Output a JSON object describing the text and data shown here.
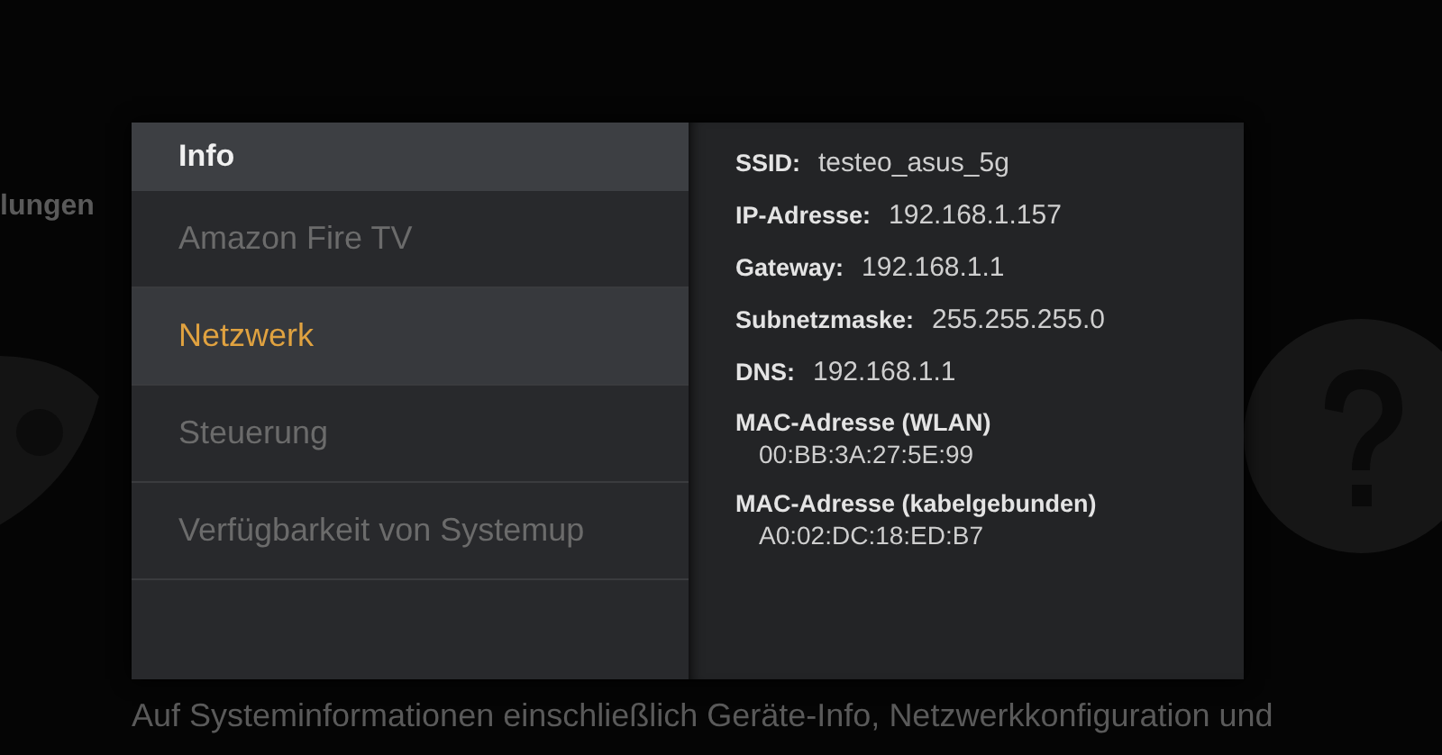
{
  "background": {
    "left_label": "lungen",
    "description": "Auf Systeminformationen einschließlich Geräte-Info, Netzwerkkonfiguration und"
  },
  "menu": {
    "title": "Info",
    "items": [
      {
        "label": "Amazon Fire TV",
        "selected": false
      },
      {
        "label": "Netzwerk",
        "selected": true
      },
      {
        "label": "Steuerung",
        "selected": false
      },
      {
        "label": "Verfügbarkeit von Systemup",
        "selected": false
      }
    ]
  },
  "details": [
    {
      "kind": "inline",
      "label": "SSID:",
      "value": "testeo_asus_5g"
    },
    {
      "kind": "inline",
      "label": "IP-Adresse:",
      "value": "192.168.1.157"
    },
    {
      "kind": "inline",
      "label": "Gateway:",
      "value": "192.168.1.1"
    },
    {
      "kind": "inline",
      "label": "Subnetzmaske:",
      "value": "255.255.255.0"
    },
    {
      "kind": "inline",
      "label": "DNS:",
      "value": "192.168.1.1"
    },
    {
      "kind": "stacked",
      "label": "MAC-Adresse (WLAN)",
      "value": "00:BB:3A:27:5E:99"
    },
    {
      "kind": "stacked",
      "label": "MAC-Adresse (kabelgebunden)",
      "value": "A0:02:DC:18:ED:B7"
    }
  ]
}
